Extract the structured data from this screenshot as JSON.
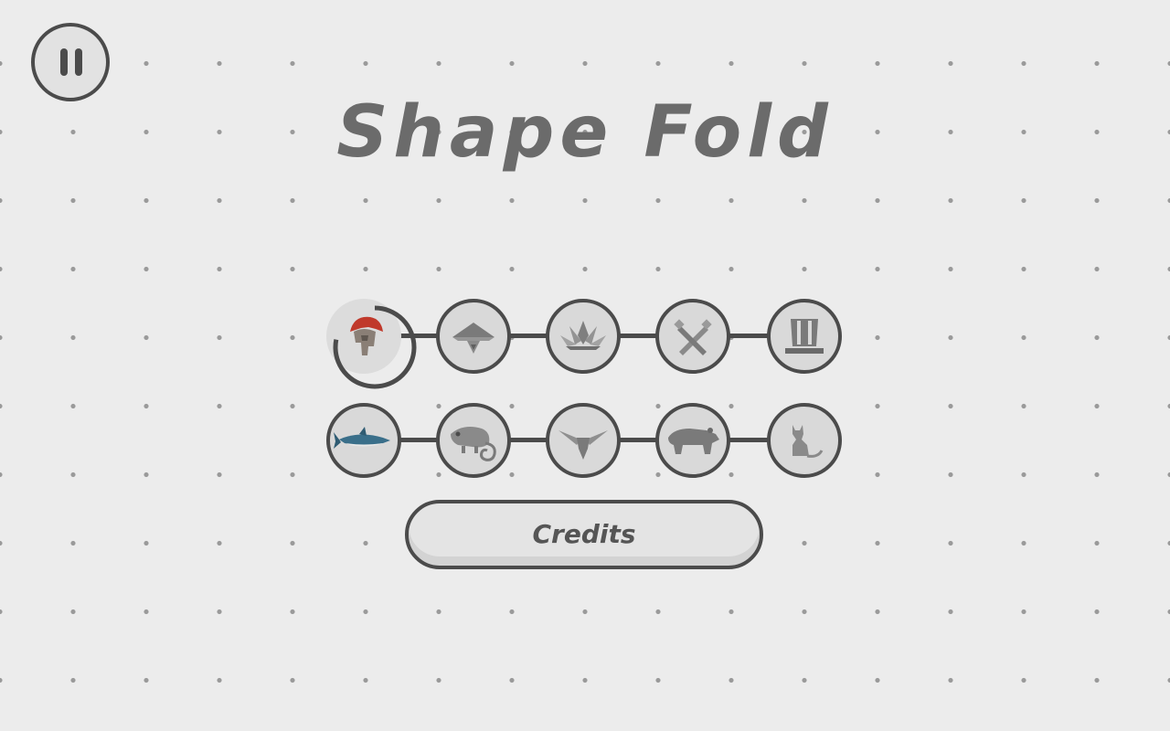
{
  "game": {
    "title": "Shape Fold",
    "credits_label": "Credits",
    "pause_icon": "pause-icon"
  },
  "colors": {
    "background": "#ececec",
    "dot": "#9a9a9a",
    "outline": "#4b4b4b",
    "button_fill": "#d9d9d9",
    "icon_gray": "#8f8f8f",
    "accent_red": "#c0392b",
    "shark_blue": "#3a6f8a"
  },
  "levels": {
    "row1": [
      {
        "id": "spartan-helmet",
        "icon": "spartan-helmet-icon",
        "selected": true,
        "progress": 0.78
      },
      {
        "id": "samurai-hat",
        "icon": "samurai-hat-icon",
        "selected": false
      },
      {
        "id": "lotus",
        "icon": "lotus-icon",
        "selected": false
      },
      {
        "id": "crossed-swords",
        "icon": "crossed-swords-icon",
        "selected": false
      },
      {
        "id": "top-hat",
        "icon": "top-hat-icon",
        "selected": false
      }
    ],
    "row2": [
      {
        "id": "shark",
        "icon": "shark-icon",
        "selected": false
      },
      {
        "id": "chameleon",
        "icon": "chameleon-icon",
        "selected": false
      },
      {
        "id": "bird",
        "icon": "bird-icon",
        "selected": false
      },
      {
        "id": "bear",
        "icon": "bear-icon",
        "selected": false
      },
      {
        "id": "cat",
        "icon": "cat-icon",
        "selected": false
      }
    ]
  }
}
